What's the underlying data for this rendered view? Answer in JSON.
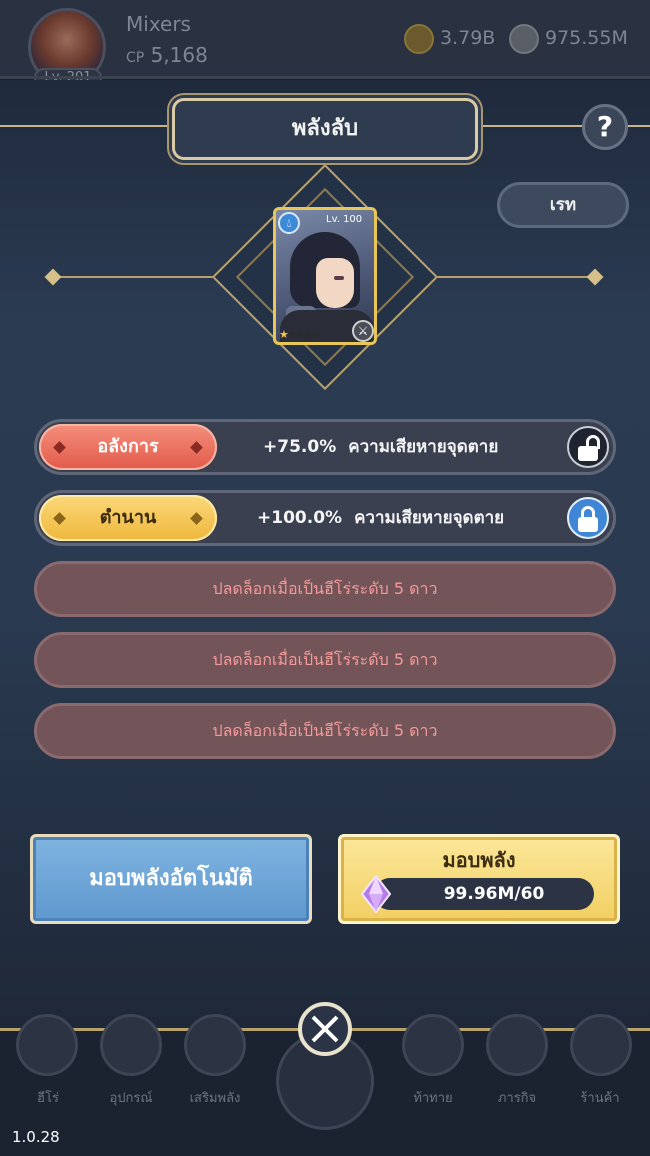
{
  "player": {
    "name": "Mixers",
    "cp_label": "CP",
    "cp_value": "5,168",
    "level_label": "Lv.",
    "level": "201",
    "gold": "3.79B",
    "gems": "975.55M"
  },
  "dialog": {
    "title": "พลังลับ",
    "help_label": "?",
    "rate_button": "เรท"
  },
  "hero": {
    "level_text": "Lv. 100",
    "element_icon": "water-drop-icon",
    "weapon_icon": "sword-icon",
    "stars_total": 5,
    "stars_filled": 1
  },
  "abilities": [
    {
      "tag": "อลังการ",
      "value": "+75.0%",
      "stat": "ความเสียหายจุดตาย",
      "locked": false
    },
    {
      "tag": "ตำนาน",
      "value": "+100.0%",
      "stat": "ความเสียหายจุดตาย",
      "locked": true
    }
  ],
  "locked_slots": [
    "ปลดล็อกเมื่อเป็นฮีโร่ระดับ 5 ดาว",
    "ปลดล็อกเมื่อเป็นฮีโร่ระดับ 5 ดาว",
    "ปลดล็อกเมื่อเป็นฮีโร่ระดับ 5 ดาว"
  ],
  "actions": {
    "auto_label": "มอบพลังอัตโนมัติ",
    "empower_label": "มอบพลัง",
    "cost": "99.96M/60",
    "cost_icon": "purple-crystal-icon"
  },
  "nav": {
    "items": [
      {
        "label": "ฮีโร่",
        "icon": "hero-icon"
      },
      {
        "label": "อุปกรณ์",
        "icon": "equipment-icon"
      },
      {
        "label": "เสริมพลัง",
        "icon": "book-icon"
      },
      {
        "label": "ท้าทาย",
        "icon": "challenge-icon"
      },
      {
        "label": "ภารกิจ",
        "icon": "quest-icon"
      },
      {
        "label": "ร้านค้า",
        "icon": "shop-icon"
      }
    ]
  },
  "version": "1.0.28",
  "colors": {
    "panel_bg": "#2b3b52",
    "accent_gold": "#d9cba6",
    "tag_glamorous": "#e25a4a",
    "tag_legend": "#efb73c",
    "locked_row": "#735458",
    "auto_button": "#5f98cf",
    "empower_button": "#f2cf62"
  }
}
